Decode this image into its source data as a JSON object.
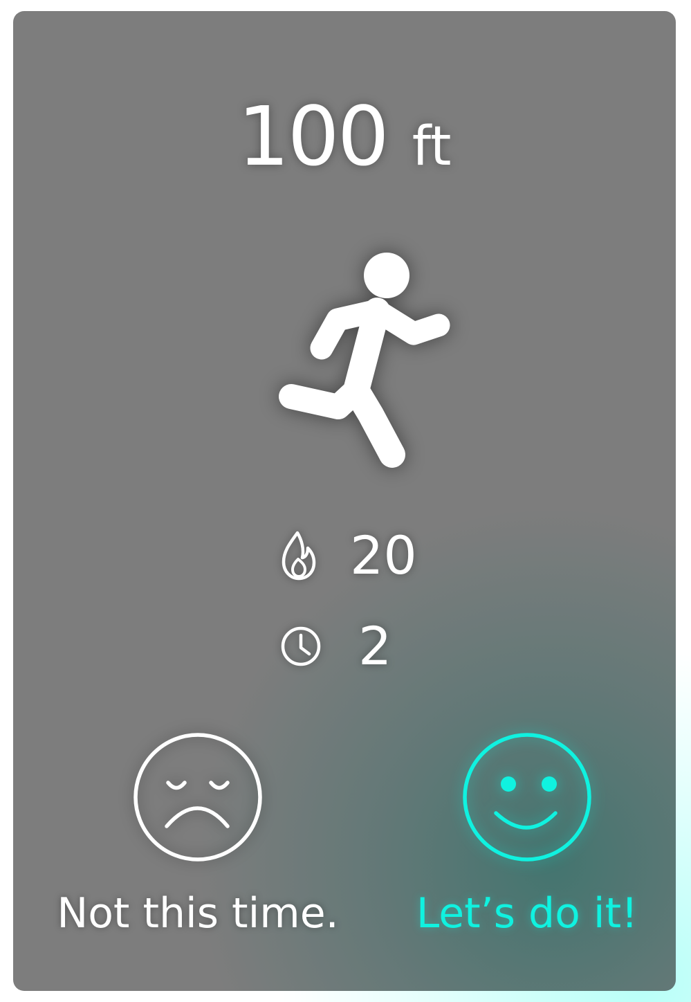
{
  "activity": {
    "distance_value": "100",
    "distance_unit": "ft",
    "activity_icon": "running-person-icon"
  },
  "stats": {
    "calories_icon": "flame-icon",
    "calories": "20",
    "time_icon": "clock-icon",
    "time": "2"
  },
  "choices": {
    "decline_icon": "sad-face-icon",
    "decline_label": "Not this time.",
    "accept_icon": "smiley-face-icon",
    "accept_label": "Let’s do it!"
  },
  "colors": {
    "card_background": "#7d7d7d",
    "text": "#ffffff",
    "accent": "#10f2e0"
  }
}
